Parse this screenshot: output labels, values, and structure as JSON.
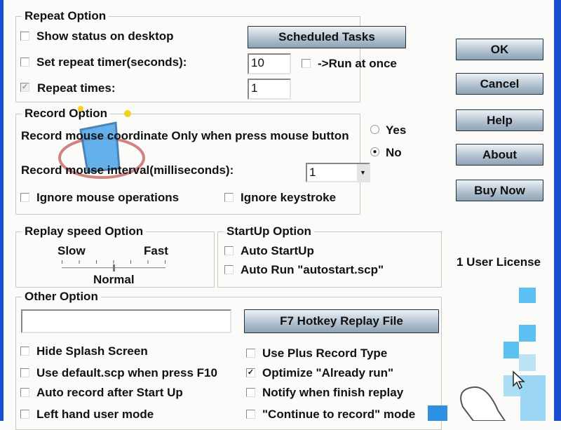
{
  "repeat": {
    "title": "Repeat Option",
    "show_status": "Show status on desktop",
    "scheduled_tasks": "Scheduled Tasks",
    "set_timer": "Set repeat timer(seconds):",
    "timer_value": "10",
    "run_at_once": "->Run at once",
    "repeat_times": "Repeat times:",
    "repeat_times_value": "1",
    "repeat_times_checked": true
  },
  "record": {
    "title": "Record Option",
    "coord_label": "Record mouse coordinate Only when press mouse button",
    "yes": "Yes",
    "no": "No",
    "selected": "No",
    "interval_label": "Record mouse interval(milliseconds):",
    "interval_value": "1",
    "ignore_mouse": "Ignore mouse operations",
    "ignore_keys": "Ignore keystroke"
  },
  "replay": {
    "title": "Replay speed Option",
    "slow": "Slow",
    "fast": "Fast",
    "normal": "Normal",
    "speed_position": "Normal"
  },
  "startup": {
    "title": "StartUp Option",
    "auto_startup": "Auto StartUp",
    "auto_run": "Auto Run \"autostart.scp\""
  },
  "other": {
    "title": "Other Option",
    "file_value": "",
    "hotkey_button": "F7 Hotkey Replay File",
    "hide_splash": "Hide Splash Screen",
    "use_default": "Use default.scp when press F10",
    "auto_record": "Auto record after Start Up",
    "left_hand": "Left hand user mode",
    "plus_record": "Use Plus Record Type",
    "optimize": "Optimize \"Already run\"",
    "optimize_checked": true,
    "notify": "Notify when finish replay",
    "continue_record": "\"Continue to record\" mode"
  },
  "side": {
    "ok": "OK",
    "cancel": "Cancel",
    "help": "Help",
    "about": "About",
    "buy_now": "Buy Now",
    "license": "1 User License"
  },
  "colors": {
    "accent": "#1a4fd0",
    "button": "#aebfcd",
    "decor": "#5cc0f0"
  }
}
